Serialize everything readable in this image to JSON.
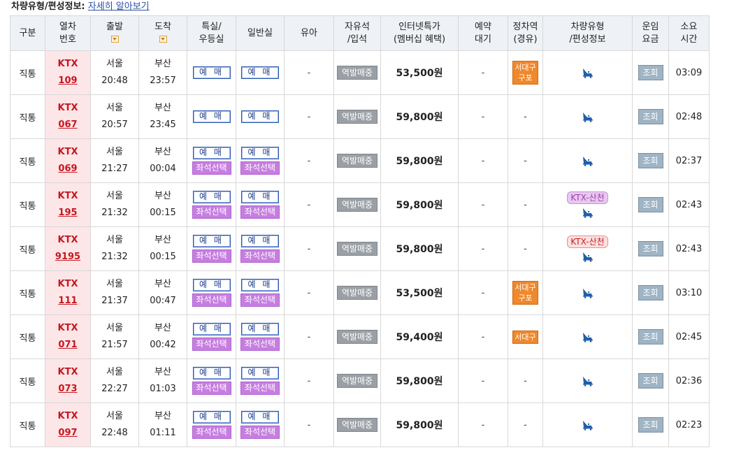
{
  "header": {
    "label": "차량유형/편성정보:",
    "link": "자세히 알아보기"
  },
  "columns": {
    "type": "구분",
    "train_no_1": "열차",
    "train_no_2": "번호",
    "dep": "출발",
    "arr": "도착",
    "special_1": "특실/",
    "special_2": "우등실",
    "general": "일반실",
    "infant": "유아",
    "standing_1": "자유석",
    "standing_2": "/입석",
    "fare_1": "인터넷특가",
    "fare_2": "(멤버십 혜택)",
    "wait_1": "예약",
    "wait_2": "대기",
    "stop_1": "정차역",
    "stop_2": "(경유)",
    "car_1": "차량유형",
    "car_2": "/편성정보",
    "faretbl_1": "운임",
    "faretbl_2": "요금",
    "dur_1": "소요",
    "dur_2": "시간"
  },
  "labels": {
    "reserve": "예 매",
    "seat_select": "좌석선택",
    "station_sale": "역발매중",
    "inquiry": "조회",
    "dash": "-"
  },
  "rows": [
    {
      "type": "직통",
      "train": "KTX",
      "no": "109",
      "dep_st": "서울",
      "dep_t": "20:48",
      "arr_st": "부산",
      "arr_t": "23:57",
      "seat": false,
      "fare": "53,500원",
      "stops": [
        "서대구",
        "구포"
      ],
      "car": "",
      "dur": "03:09"
    },
    {
      "type": "직통",
      "train": "KTX",
      "no": "067",
      "dep_st": "서울",
      "dep_t": "20:57",
      "arr_st": "부산",
      "arr_t": "23:45",
      "seat": false,
      "fare": "59,800원",
      "stops": [],
      "car": "",
      "dur": "02:48"
    },
    {
      "type": "직통",
      "train": "KTX",
      "no": "069",
      "dep_st": "서울",
      "dep_t": "21:27",
      "arr_st": "부산",
      "arr_t": "00:04",
      "seat": true,
      "fare": "59,800원",
      "stops": [],
      "car": "",
      "dur": "02:37"
    },
    {
      "type": "직통",
      "train": "KTX",
      "no": "195",
      "dep_st": "서울",
      "dep_t": "21:32",
      "arr_st": "부산",
      "arr_t": "00:15",
      "seat": true,
      "fare": "59,800원",
      "stops": [],
      "car": "KTX-산천",
      "car_color": "purple",
      "dur": "02:43"
    },
    {
      "type": "직통",
      "train": "KTX",
      "no": "9195",
      "dep_st": "서울",
      "dep_t": "21:32",
      "arr_st": "부산",
      "arr_t": "00:15",
      "seat": true,
      "fare": "59,800원",
      "stops": [],
      "car": "KTX-산천",
      "car_color": "red",
      "dur": "02:43"
    },
    {
      "type": "직통",
      "train": "KTX",
      "no": "111",
      "dep_st": "서울",
      "dep_t": "21:37",
      "arr_st": "부산",
      "arr_t": "00:47",
      "seat": true,
      "fare": "53,500원",
      "stops": [
        "서대구",
        "구포"
      ],
      "car": "",
      "dur": "03:10"
    },
    {
      "type": "직통",
      "train": "KTX",
      "no": "071",
      "dep_st": "서울",
      "dep_t": "21:57",
      "arr_st": "부산",
      "arr_t": "00:42",
      "seat": true,
      "fare": "59,400원",
      "stops": [
        "서대구"
      ],
      "car": "",
      "dur": "02:45"
    },
    {
      "type": "직통",
      "train": "KTX",
      "no": "073",
      "dep_st": "서울",
      "dep_t": "22:27",
      "arr_st": "부산",
      "arr_t": "01:03",
      "seat": true,
      "fare": "59,800원",
      "stops": [],
      "car": "",
      "dur": "02:36"
    },
    {
      "type": "직통",
      "train": "KTX",
      "no": "097",
      "dep_st": "서울",
      "dep_t": "22:48",
      "arr_st": "부산",
      "arr_t": "01:11",
      "seat": true,
      "fare": "59,800원",
      "stops": [],
      "car": "",
      "dur": "02:23"
    }
  ],
  "colors": {
    "train_cell_bg": "#fde6e8",
    "train_text": "#c8161e",
    "seat_btn": "#c67ee0",
    "stop_tag": "#f0882c",
    "header_bg": "#eef1f5"
  }
}
